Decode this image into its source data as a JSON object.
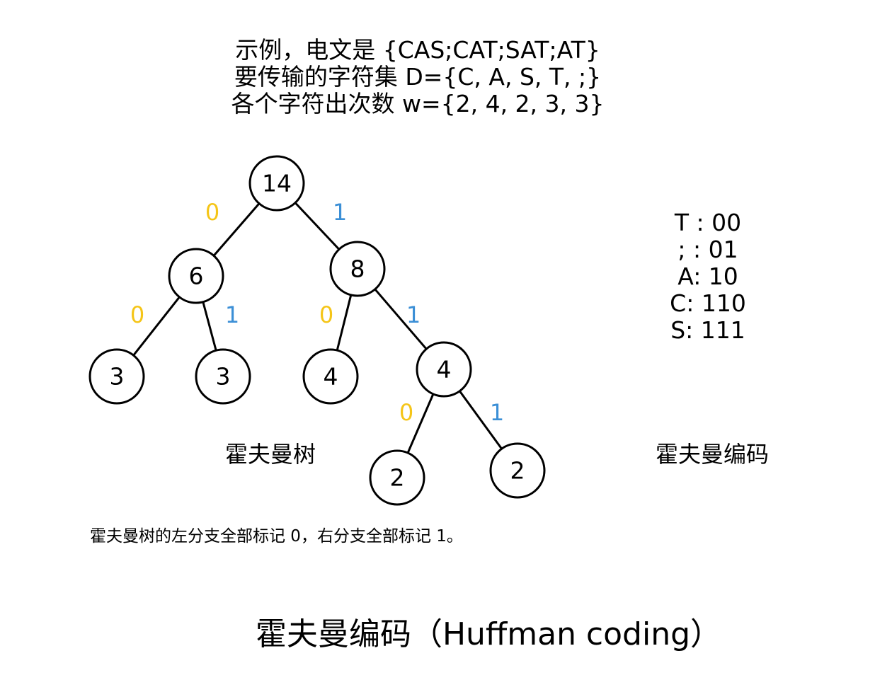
{
  "header": {
    "lines": [
      "示例，电文是 {CAS;CAT;SAT;AT}",
      "要传输的字符集 D={C, A, S, T, ;}",
      "各个字符出次数 w={2, 4, 2, 3, 3}"
    ]
  },
  "tree": {
    "nodes": [
      {
        "id": "root",
        "label": "14"
      },
      {
        "id": "n6",
        "label": "6"
      },
      {
        "id": "n8",
        "label": "8"
      },
      {
        "id": "n3a",
        "label": "3"
      },
      {
        "id": "n3b",
        "label": "3"
      },
      {
        "id": "n4a",
        "label": "4"
      },
      {
        "id": "n4b",
        "label": "4"
      },
      {
        "id": "n2a",
        "label": "2"
      },
      {
        "id": "n2b",
        "label": "2"
      }
    ],
    "edges": [
      {
        "from": "root",
        "to": "n6",
        "bit": "0"
      },
      {
        "from": "root",
        "to": "n8",
        "bit": "1"
      },
      {
        "from": "n6",
        "to": "n3a",
        "bit": "0"
      },
      {
        "from": "n6",
        "to": "n3b",
        "bit": "1"
      },
      {
        "from": "n8",
        "to": "n4a",
        "bit": "0"
      },
      {
        "from": "n8",
        "to": "n4b",
        "bit": "1"
      },
      {
        "from": "n4b",
        "to": "n2a",
        "bit": "0"
      },
      {
        "from": "n4b",
        "to": "n2b",
        "bit": "1"
      }
    ],
    "colors": {
      "zero": "#f5c518",
      "one": "#3b8fd6",
      "stroke": "#000000"
    }
  },
  "codes": [
    "T :  00",
    ";  :  01",
    "A:  10",
    "C: 110",
    "S: 111"
  ],
  "captions": {
    "tree": "霍夫曼树",
    "code": "霍夫曼编码",
    "note": "霍夫曼树的左分支全部标记 0，右分支全部标记 1。",
    "title": "霍夫曼编码（Huffman coding）"
  }
}
